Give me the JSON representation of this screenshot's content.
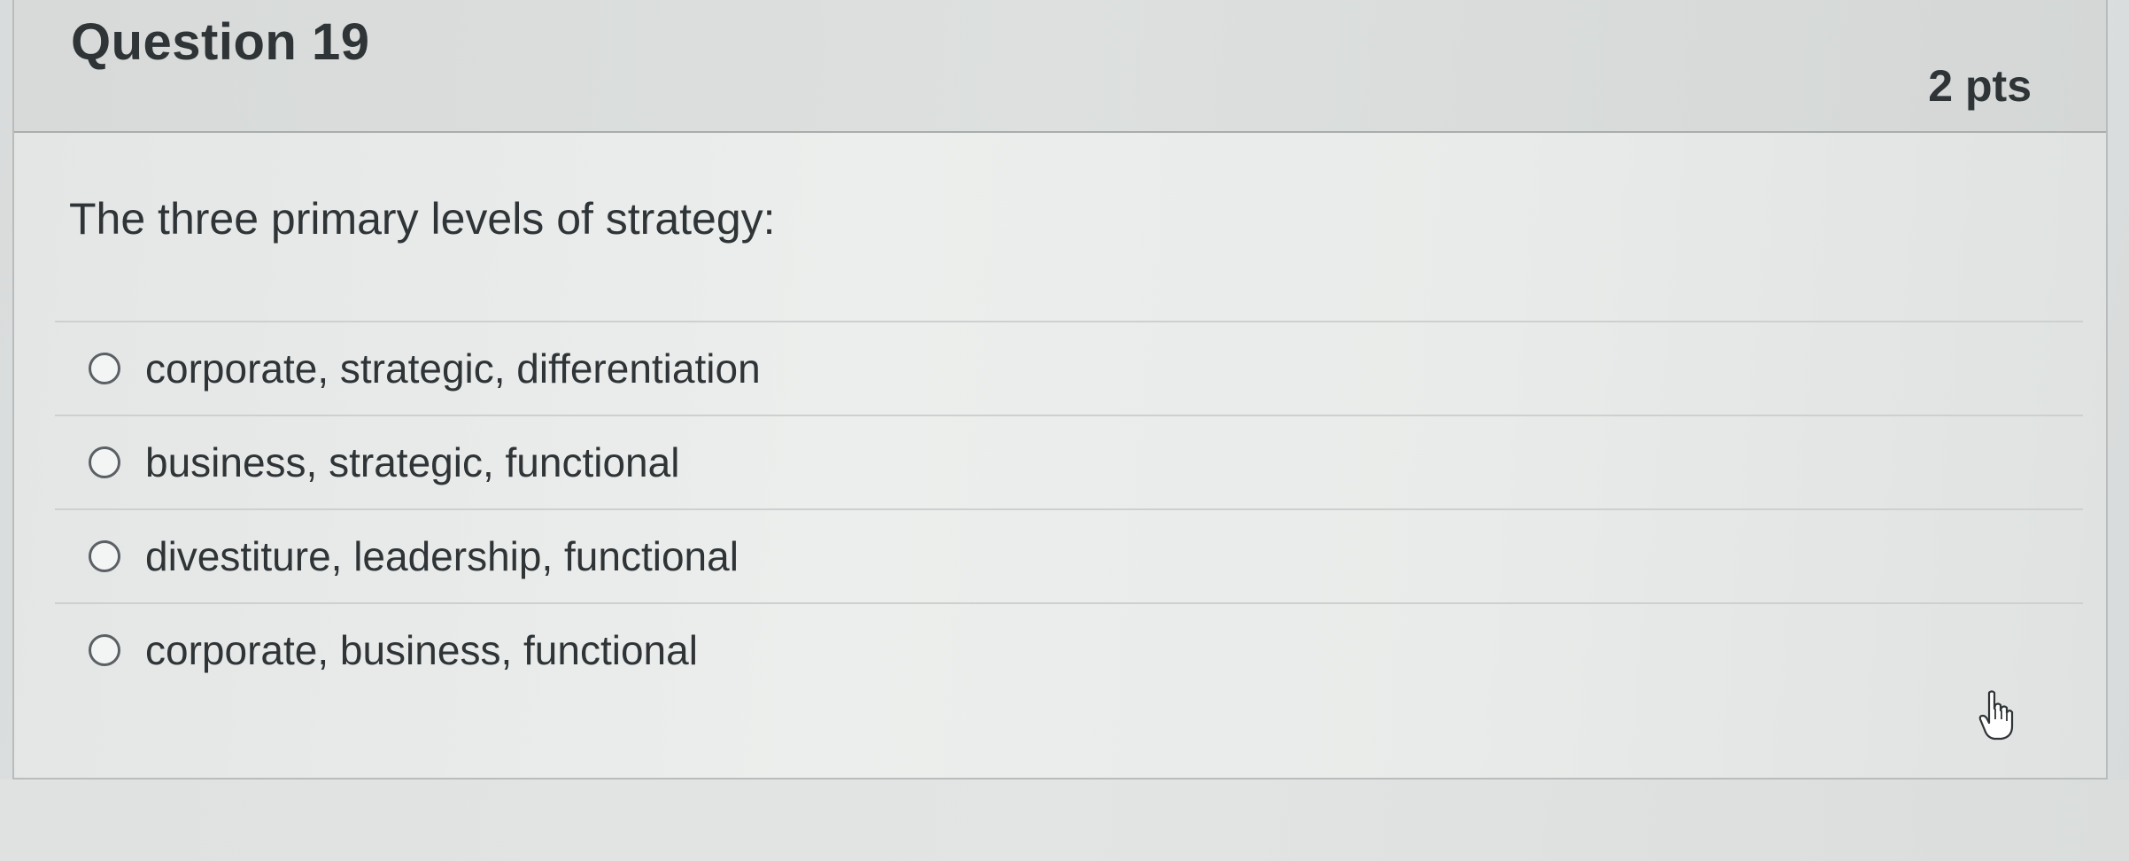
{
  "question": {
    "title": "Question 19",
    "points": "2 pts",
    "text": "The three primary levels of strategy:"
  },
  "answers": [
    {
      "label": "corporate, strategic, differentiation",
      "selected": false
    },
    {
      "label": "business, strategic, functional",
      "selected": false
    },
    {
      "label": "divestiture, leadership, functional",
      "selected": false
    },
    {
      "label": "corporate, business, functional",
      "selected": false
    }
  ],
  "cursor": "hand-pointer-icon"
}
